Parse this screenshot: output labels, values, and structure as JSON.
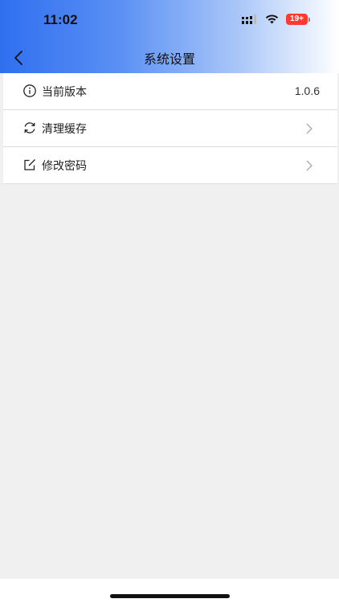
{
  "status_bar": {
    "time": "11:02",
    "battery_label": "19+",
    "battery_color": "#ff3b30",
    "icons": [
      "signal-icon",
      "wifi-icon",
      "battery-icon"
    ]
  },
  "nav": {
    "title": "系统设置",
    "back_icon": "chevron-left-icon"
  },
  "settings": {
    "items": [
      {
        "icon": "info-icon",
        "label": "当前版本",
        "value": "1.0.6"
      },
      {
        "icon": "refresh-icon",
        "label": "清理缓存",
        "trailing": "chevron-right-icon"
      },
      {
        "icon": "edit-icon",
        "label": "修改密码",
        "trailing": "chevron-right-icon"
      }
    ]
  },
  "colors": {
    "header_start": "#2f6ff0",
    "header_end": "#ffffff",
    "page_background": "#f0f0f0"
  }
}
